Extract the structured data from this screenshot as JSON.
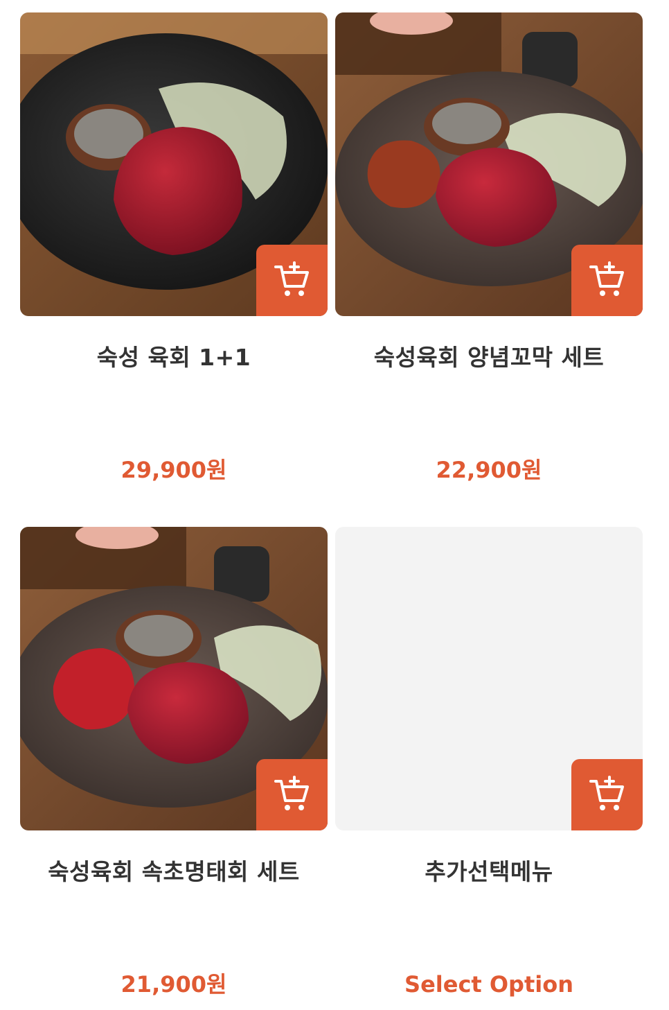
{
  "products": [
    {
      "name": "숙성 육회 1+1",
      "price": "29,900원",
      "image": "yukhoe-single-plate-photo"
    },
    {
      "name": "숙성육회 양념꼬막 세트",
      "price": "22,900원",
      "image": "yukhoe-cockle-set-photo"
    },
    {
      "name": "숙성육회 속초명태회 세트",
      "price": "21,900원",
      "image": "yukhoe-pollack-set-photo"
    },
    {
      "name": "추가선택메뉴",
      "price": "Select Option",
      "image": ""
    }
  ],
  "icons": {
    "cart": "add-to-cart-icon"
  },
  "colors": {
    "accent": "#e05a33",
    "text": "#333333",
    "placeholder": "#f3f3f3"
  }
}
